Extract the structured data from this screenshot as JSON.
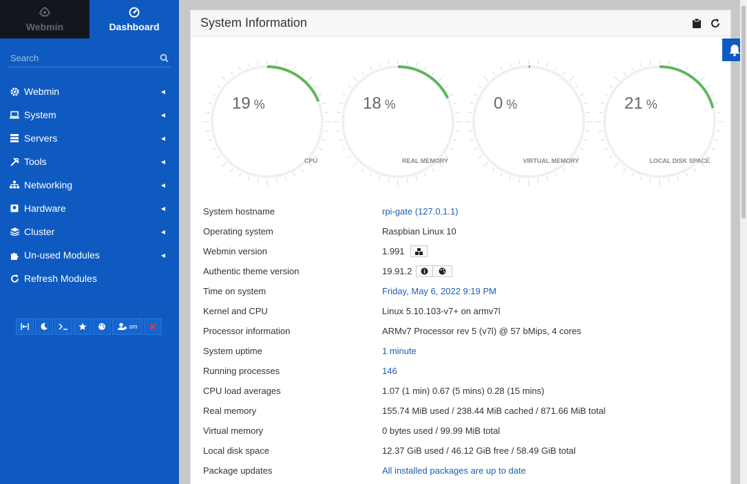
{
  "topnav": {
    "webmin_tab": "Webmin",
    "dashboard_tab": "Dashboard"
  },
  "search": {
    "placeholder": "Search"
  },
  "menu": [
    {
      "label": "Webmin",
      "icon": "gear-icon"
    },
    {
      "label": "System",
      "icon": "laptop-icon"
    },
    {
      "label": "Servers",
      "icon": "server-icon"
    },
    {
      "label": "Tools",
      "icon": "wrench-icon"
    },
    {
      "label": "Networking",
      "icon": "network-icon"
    },
    {
      "label": "Hardware",
      "icon": "hdd-icon"
    },
    {
      "label": "Cluster",
      "icon": "layers-icon"
    },
    {
      "label": "Un-used Modules",
      "icon": "puzzle-icon"
    },
    {
      "label": "Refresh Modules",
      "icon": "refresh-icon"
    }
  ],
  "toolbar": {
    "user_label": "sm"
  },
  "panel": {
    "title": "System Information"
  },
  "gauges": [
    {
      "value": 19,
      "label": "CPU"
    },
    {
      "value": 18,
      "label": "REAL MEMORY"
    },
    {
      "value": 0,
      "label": "VIRTUAL MEMORY"
    },
    {
      "value": 21,
      "label": "LOCAL DISK SPACE"
    }
  ],
  "gauge_color": "#5cb85c",
  "info": [
    {
      "key": "System hostname",
      "value": "rpi-gate (127.0.1.1)",
      "link": true
    },
    {
      "key": "Operating system",
      "value": "Raspbian Linux 10",
      "link": false
    },
    {
      "key": "Webmin version",
      "value": "1.991",
      "link": false
    },
    {
      "key": "Authentic theme version",
      "value": "19.91.2",
      "link": false
    },
    {
      "key": "Time on system",
      "value": "Friday, May 6, 2022 9:19 PM",
      "link": true
    },
    {
      "key": "Kernel and CPU",
      "value": "Linux 5.10.103-v7+ on armv7l",
      "link": false
    },
    {
      "key": "Processor information",
      "value": "ARMv7 Processor rev 5 (v7l) @ 57 bMips, 4 cores",
      "link": false
    },
    {
      "key": "System uptime",
      "value": "1 minute",
      "link": true
    },
    {
      "key": "Running processes",
      "value": "146",
      "link": true
    },
    {
      "key": "CPU load averages",
      "value": "1.07 (1 min) 0.67 (5 mins) 0.28 (15 mins)",
      "link": false
    },
    {
      "key": "Real memory",
      "value": "155.74 MiB used / 238.44 MiB cached / 871.66 MiB total",
      "link": false
    },
    {
      "key": "Virtual memory",
      "value": "0 bytes used / 99.99 MiB total",
      "link": false
    },
    {
      "key": "Local disk space",
      "value": "12.37 GiB used / 46.12 GiB free / 58.49 GiB total",
      "link": false
    },
    {
      "key": "Package updates",
      "value": "All installed packages are up to date",
      "link": true
    }
  ]
}
